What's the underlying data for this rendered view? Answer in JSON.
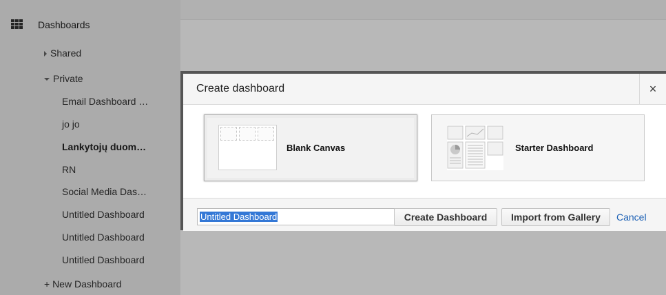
{
  "sidebar": {
    "title": "Dashboards",
    "shared_label": "Shared",
    "private_label": "Private",
    "items": [
      {
        "label": "Email Dashboard …",
        "bold": false
      },
      {
        "label": "jo jo",
        "bold": false
      },
      {
        "label": "Lankytojų duom…",
        "bold": true
      },
      {
        "label": "RN",
        "bold": false
      },
      {
        "label": "Social Media Das…",
        "bold": false
      },
      {
        "label": "Untitled Dashboard",
        "bold": false
      },
      {
        "label": "Untitled Dashboard",
        "bold": false
      },
      {
        "label": "Untitled Dashboard",
        "bold": false
      }
    ],
    "new_label": "+ New Dashboard"
  },
  "dialog": {
    "title": "Create dashboard",
    "close_glyph": "×",
    "options": {
      "blank": "Blank Canvas",
      "starter": "Starter Dashboard"
    },
    "name_input_value": "Untitled Dashboard",
    "create_label": "Create Dashboard",
    "import_label": "Import from Gallery",
    "cancel_label": "Cancel"
  },
  "colors": {
    "overlay": "#000000",
    "selection": "#3478d6",
    "link": "#1a5fb4"
  }
}
